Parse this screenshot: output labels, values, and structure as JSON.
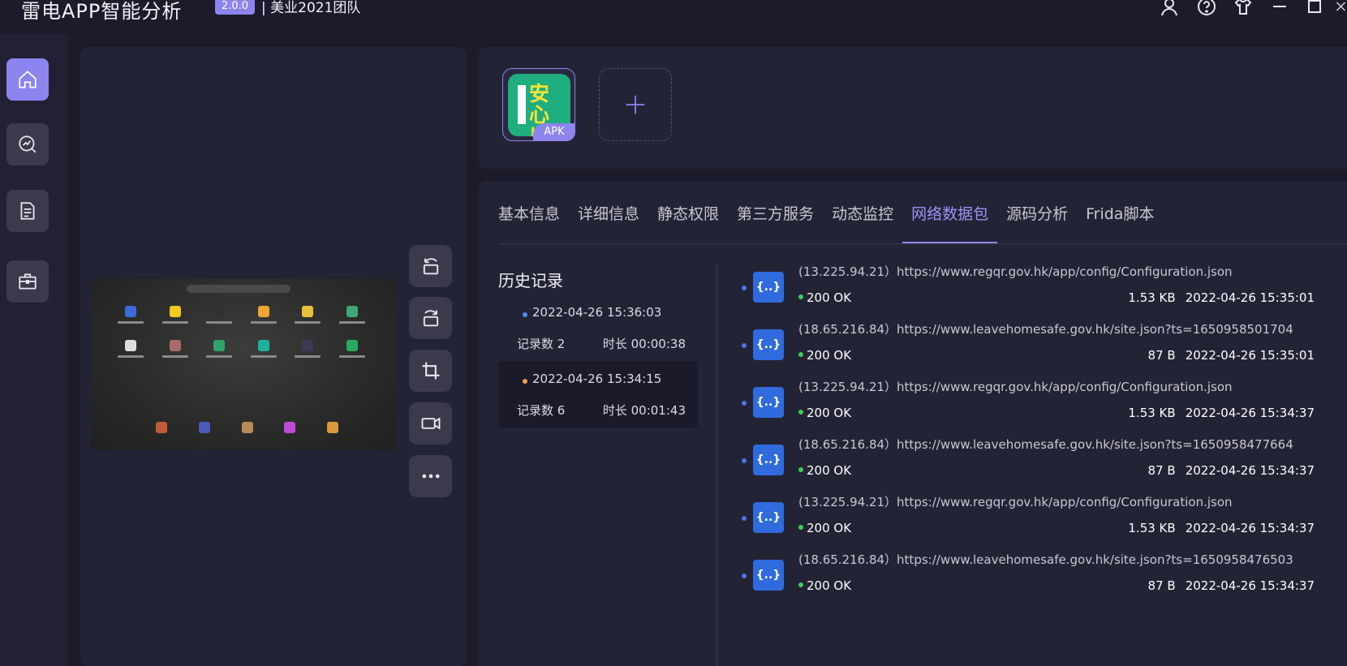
{
  "titlebar": {
    "app_name": "雷电APP智能分析",
    "version": "2.0.0",
    "team": "| 美业2021团队"
  },
  "nav": [
    {
      "icon": "home-icon"
    },
    {
      "icon": "analysis-icon"
    },
    {
      "icon": "document-icon"
    },
    {
      "icon": "toolbox-icon"
    }
  ],
  "tools": [
    {
      "icon": "rotate-left-icon"
    },
    {
      "icon": "rotate-right-icon"
    },
    {
      "icon": "crop-icon"
    },
    {
      "icon": "video-record-icon"
    },
    {
      "icon": "more-icon"
    }
  ],
  "apk": {
    "tag": "APK",
    "icon_text": "安心出行"
  },
  "tabs": [
    {
      "label": "基本信息"
    },
    {
      "label": "详细信息"
    },
    {
      "label": "静态权限"
    },
    {
      "label": "第三方服务"
    },
    {
      "label": "动态监控"
    },
    {
      "label": "网络数据包",
      "active": true
    },
    {
      "label": "源码分析"
    },
    {
      "label": "Frida脚本"
    }
  ],
  "history": {
    "title": "历史记录",
    "sessions": [
      {
        "time": "2022-04-26 15:36:03",
        "count": "记录数 2",
        "duration": "时长 00:00:38",
        "dot_color": "#4b8ef0"
      },
      {
        "time": "2022-04-26 15:34:15",
        "count": "记录数 6",
        "duration": "时长 00:01:43",
        "dot_color": "#f0a640"
      }
    ]
  },
  "requests": [
    {
      "url": "(13.225.94.21）https://www.regqr.gov.hk/app/config/Configuration.json",
      "status": "200 OK",
      "size": "1.53 KB",
      "time": "2022-04-26 15:35:01"
    },
    {
      "url": "(18.65.216.84）https://www.leavehomesafe.gov.hk/site.json?ts=1650958501704",
      "status": "200 OK",
      "size": "87 B",
      "time": "2022-04-26 15:35:01"
    },
    {
      "url": "(13.225.94.21）https://www.regqr.gov.hk/app/config/Configuration.json",
      "status": "200 OK",
      "size": "1.53 KB",
      "time": "2022-04-26 15:34:37"
    },
    {
      "url": "(18.65.216.84）https://www.leavehomesafe.gov.hk/site.json?ts=1650958477664",
      "status": "200 OK",
      "size": "87 B",
      "time": "2022-04-26 15:34:37"
    },
    {
      "url": "(13.225.94.21）https://www.regqr.gov.hk/app/config/Configuration.json",
      "status": "200 OK",
      "size": "1.53 KB",
      "time": "2022-04-26 15:34:37"
    },
    {
      "url": "(18.65.216.84）https://www.leavehomesafe.gov.hk/site.json?ts=1650958476503",
      "status": "200 OK",
      "size": "87 B",
      "time": "2022-04-26 15:34:37"
    }
  ],
  "json_icon_glyph": "{..}",
  "colors": {
    "accent": "#8c85f0",
    "ok": "#3ad05a",
    "json_icon": "#2f6bdc"
  }
}
